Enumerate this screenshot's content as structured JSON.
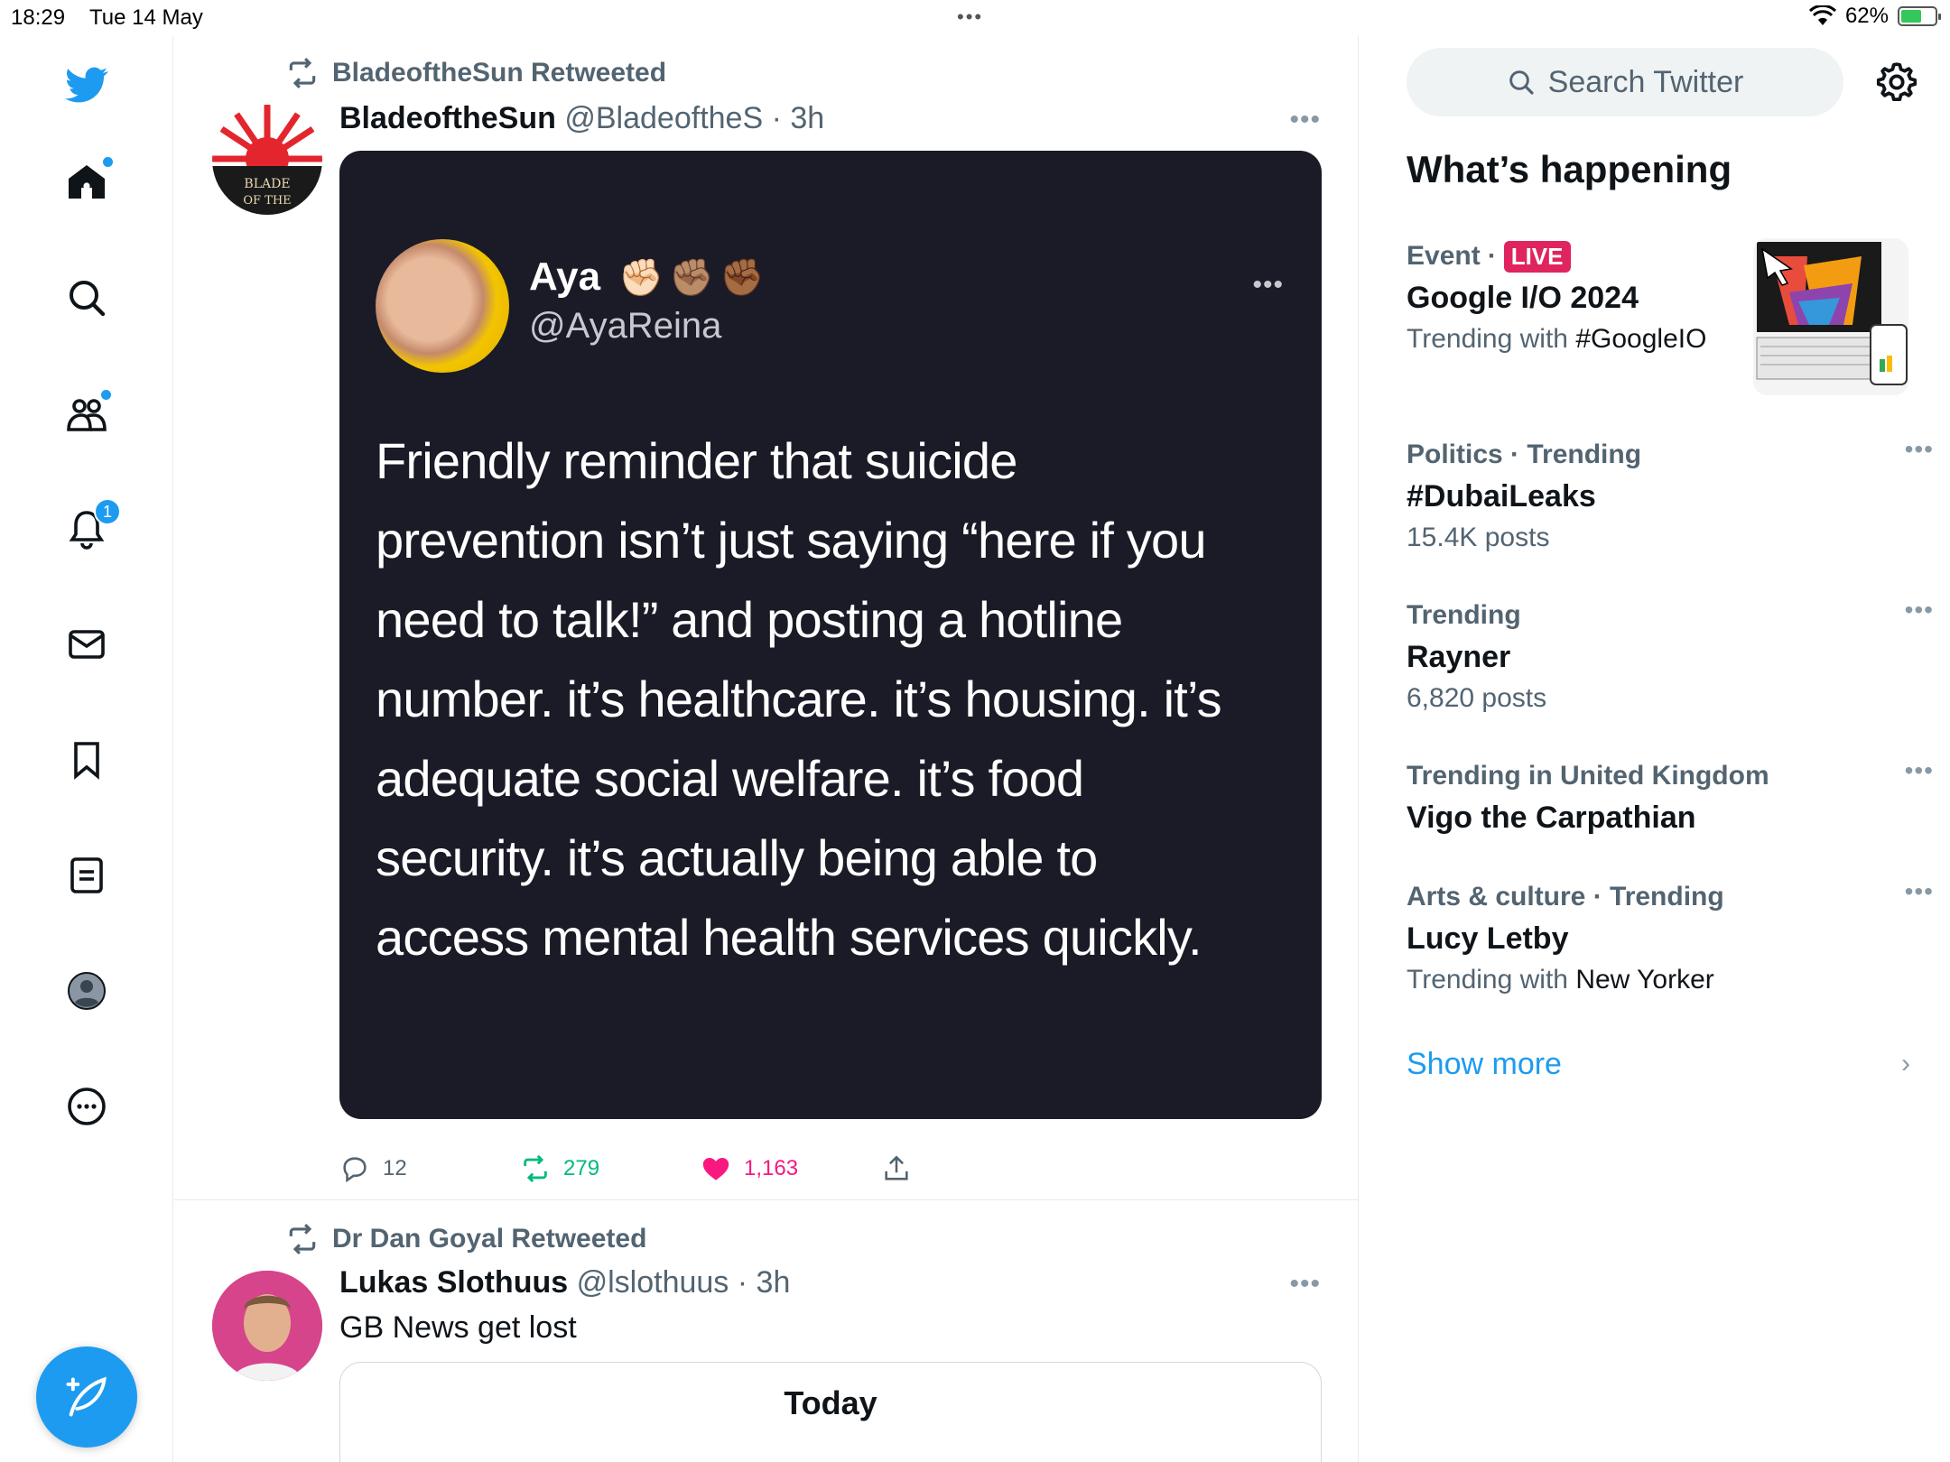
{
  "status_bar": {
    "time": "18:29",
    "date": "Tue 14 May",
    "battery": "62%",
    "battery_level": 0.62
  },
  "nav": {
    "notifications_count": "1",
    "icons": [
      "twitter-logo-icon",
      "home-icon",
      "search-icon",
      "communities-icon",
      "bell-icon",
      "mail-icon",
      "bookmark-icon",
      "lists-icon",
      "profile-icon",
      "more-icon",
      "compose-icon"
    ]
  },
  "tweets": [
    {
      "retweeted_by": "BladeoftheSun Retweeted",
      "name": "BladeoftheSun",
      "handle": "@BladeoftheS",
      "time": "· 3h",
      "avatar_text": "BLADE OF THE",
      "media": {
        "author_name": "Aya",
        "author_emojis": "✊🏻✊🏽✊🏾",
        "author_handle": "@AyaReina",
        "more": "•••",
        "lines": [
          "Friendly reminder that suicide",
          "prevention isn’t just saying “here if you",
          "need to talk!” and posting a hotline",
          "number. it’s healthcare. it’s housing. it’s",
          "adequate social welfare. it’s food",
          "security. it’s actually being able to",
          "access mental health services quickly."
        ]
      },
      "replies": "12",
      "retweets": "279",
      "likes": "1,163"
    },
    {
      "retweeted_by": "Dr Dan Goyal Retweeted",
      "name": "Lukas Slothuus",
      "handle": "@lslothuus",
      "time": "· 3h",
      "text": "GB News get lost",
      "card_title": "Today"
    }
  ],
  "sidebar": {
    "search_placeholder": "Search Twitter",
    "whats_happening": "What’s happening",
    "trends": [
      {
        "category": "Event",
        "sep": "·",
        "live": "LIVE",
        "title": "Google I/O 2024",
        "sub_prefix": "Trending with",
        "sub_bold": "#GoogleIO"
      },
      {
        "category": "Politics · Trending",
        "title": "#DubaiLeaks",
        "sub": "15.4K posts"
      },
      {
        "category": "Trending",
        "title": "Rayner",
        "sub": "6,820 posts"
      },
      {
        "category": "Trending in United Kingdom",
        "title": "Vigo the Carpathian"
      },
      {
        "category": "Arts & culture · Trending",
        "title": "Lucy Letby",
        "sub_prefix": "Trending with",
        "sub_bold": "New Yorker"
      }
    ],
    "trend_more": "•••",
    "show_more": "Show more",
    "chevron": "›"
  },
  "colors": {
    "brand": "#1d9bf0",
    "like": "#f91880",
    "retweet": "#00ba7c",
    "live": "#e0245e"
  }
}
